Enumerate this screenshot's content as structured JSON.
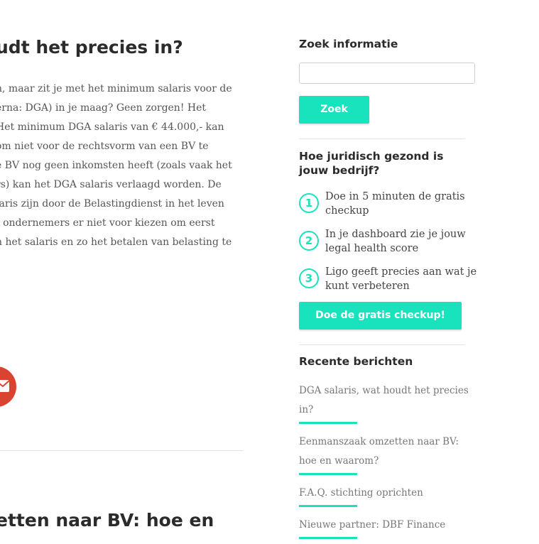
{
  "article": {
    "title": "udt het precies in?",
    "body_lines": [
      "n, maar zit je met het minimum salaris voor de",
      "erna: DGA) in je maag? Geen zorgen! Het",
      "Het minimum DGA salaris van € 44.000,- kan",
      " om niet voor de rechtsvorm van een BV te",
      "e BV nog geen inkomsten heeft (zoals vaak het",
      "rs) kan het DGA salaris verlaagd worden. De",
      "laris zijn door de Belastingdienst in het leven",
      "t ondernemers er niet voor kiezen om eerst",
      "n het salaris en zo het betalen van belasting te"
    ],
    "share_icon": "mail-icon",
    "next_title": "etten naar BV: hoe en"
  },
  "sidebar": {
    "search_heading": "Zoek informatie",
    "search_placeholder": "",
    "search_button": "Zoek",
    "health_heading": "Hoe juridisch gezond is jouw bedrijf?",
    "steps": [
      {
        "number": "1",
        "text": "Doe in 5 minuten de gratis checkup"
      },
      {
        "number": "2",
        "text": "In je dashboard zie je jouw legal health score"
      },
      {
        "number": "3",
        "text": "Ligo geeft precies aan wat je kunt verbeteren"
      }
    ],
    "checkup_button": "Doe de gratis checkup!",
    "recent_heading": "Recente berichten",
    "recent_posts": [
      "DGA salaris, wat houdt het precies in?",
      "Eenmanszaak omzetten naar BV: hoe en waarom?",
      "F.A.Q. stichting oprichten",
      "Nieuwe partner: DBF Finance"
    ]
  },
  "colors": {
    "accent": "#19e3bd",
    "share_red": "#d9432f",
    "heading": "#2b2b2b"
  }
}
